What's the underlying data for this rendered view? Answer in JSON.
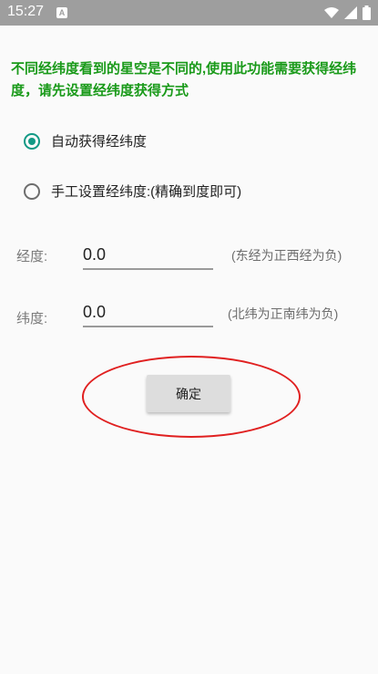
{
  "status_bar": {
    "time": "15:27",
    "app_badge": "A",
    "icons": [
      "wifi-icon",
      "signal-icon",
      "battery-icon"
    ]
  },
  "intro_text": "不同经纬度看到的星空是不同的,使用此功能需要获得经纬度，请先设置经纬度获得方式",
  "location_mode": {
    "options": [
      {
        "label": "自动获得经纬度",
        "checked": true
      },
      {
        "label": "手工设置经纬度:(精确到度即可)",
        "checked": false
      }
    ]
  },
  "longitude": {
    "label": "经度:",
    "value": "0.0",
    "hint": "(东经为正西经为负)"
  },
  "latitude": {
    "label": "纬度:",
    "value": "0.0",
    "hint": "(北纬为正南纬为负)"
  },
  "confirm_button": {
    "label": "确定"
  },
  "colors": {
    "intro_text": "#1a9a1a",
    "radio_accent": "#129985",
    "highlight_ring": "#e02020",
    "status_bar": "#9e9e9e"
  }
}
